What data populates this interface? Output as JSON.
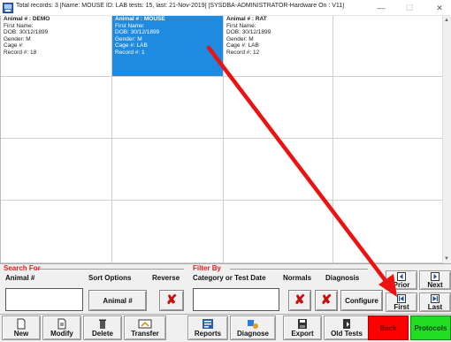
{
  "window": {
    "title": "Total records: 3  [Name: MOUSE ID: LAB tests: 15, last: 21-Nov-2019] [SYSDBA-ADMINISTRATOR-Hardware On : V11]",
    "minimize": "—",
    "maximize": "☐",
    "close": "✕"
  },
  "records": [
    {
      "head": "Animal # : DEMO",
      "first": "First Name:",
      "dob": "DOB: 30/12/1899",
      "gender": "Gender: M",
      "cage": "Cage #:",
      "record": "Record #: 18",
      "selected": false
    },
    {
      "head": "Animal # : MOUSE",
      "first": "First Name:",
      "dob": "DOB: 30/12/1899",
      "gender": "Gender: M",
      "cage": "Cage #: LAB",
      "record": "Record #: 1",
      "selected": true
    },
    {
      "head": "Animal # : RAT",
      "first": "First Name:",
      "dob": "DOB: 30/12/1899",
      "gender": "Gender: M",
      "cage": "Cage #: LAB",
      "record": "Record #: 12",
      "selected": false
    }
  ],
  "search": {
    "legend": "Search For",
    "animal_label": "Animal #",
    "animal_value": "",
    "sort_label": "Sort Options",
    "sort_button": "Animal #",
    "reverse_label": "Reverse"
  },
  "filter": {
    "legend": "Filter By",
    "category_label": "Category or Test Date",
    "category_value": "",
    "normals_label": "Normals",
    "diagnosis_label": "Diagnosis",
    "configure_button": "Configure"
  },
  "nav": {
    "prior": "Prior",
    "next": "Next",
    "first": "First",
    "last": "Last"
  },
  "toolbar": {
    "new": "New",
    "modify": "Modify",
    "delete": "Delete",
    "transfer": "Transfer",
    "reports": "Reports",
    "diagnose": "Diagnose",
    "export": "Export",
    "old_tests": "Old Tests",
    "back": "Back",
    "protocols": "Protocols"
  },
  "colors": {
    "selection": "#1e8ae0",
    "legend_red": "#e02020",
    "back_red": "#ff0000",
    "protocols_green": "#22dd22",
    "annotation_arrow": "#ee1111"
  }
}
